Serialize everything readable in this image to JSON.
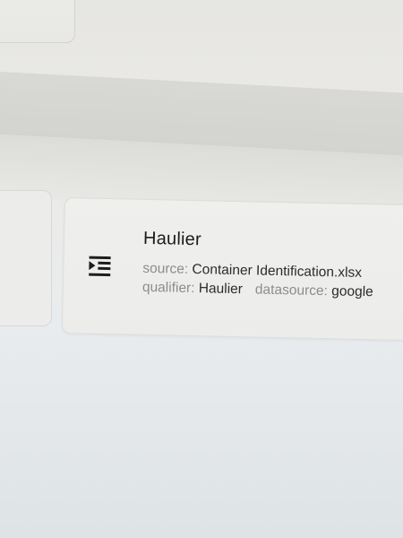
{
  "result": {
    "title": "Haulier",
    "icon": "list-indent-icon",
    "source_key": "source:",
    "source_value": "Container Identification.xlsx",
    "qualifier_key": "qualifier:",
    "qualifier_value": "Haulier",
    "datasource_key": "datasource:",
    "datasource_value": "google"
  }
}
